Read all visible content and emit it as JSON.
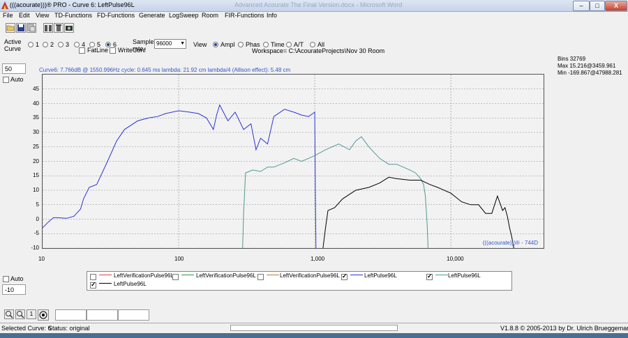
{
  "window": {
    "title": "(((acourate)))® PRO - Curve 6: LeftPulse96L",
    "background_title": "Advanced Acourate The Final Version.docx - Microsoft Word",
    "controls": [
      "–",
      "□",
      "X"
    ]
  },
  "menu": [
    "File",
    "Edit",
    "View",
    "TD-Functions",
    "FD-Functions",
    "Generate",
    "LogSweep",
    "Room",
    "FIR-Functions",
    "Info"
  ],
  "toolbar": {
    "fatline_label": "FatLine",
    "writeconf_label": "WriteConf",
    "workspace_label": "Workspace= C:\\AcourateProjects\\Nov 30 Room"
  },
  "controls": {
    "active_curve_label": "Active Curve",
    "curve_options": [
      "1",
      "2",
      "3",
      "4",
      "5",
      "6"
    ],
    "selected_curve": "6",
    "sample_rate_label": "Sample rate",
    "sample_rate_value": "96000",
    "view_label": "View",
    "view_options": [
      "Ampl",
      "Phas",
      "Time",
      "A/T",
      "All"
    ],
    "selected_view": "Ampl"
  },
  "plot": {
    "ymax_value": "50",
    "ymin_value": "-10",
    "auto_label": "Auto",
    "info_line": "Curve6:  7.766dB @ 1550.996Hz   cycle: 0.645 ms   lambda: 21.92 cm   lambda/4 (Allison effect): 5.48 cm",
    "watermark": "(((acourate)))® - 744D",
    "stats": [
      "Bins 32769",
      "Max 15.216@3459.961",
      "Min -169.867@47988.281"
    ]
  },
  "legend": [
    {
      "label": "LeftVerificationPulse96L",
      "color": "#e04040",
      "checked": false
    },
    {
      "label": "LeftVerificationPulse96L",
      "color": "#2a9a3a",
      "checked": false
    },
    {
      "label": "LeftVerificationPulse96L",
      "color": "#c07a30",
      "checked": false
    },
    {
      "label": "LeftPulse96L",
      "color": "#2a34d8",
      "checked": true
    },
    {
      "label": "LeftPulse96L",
      "color": "#4f9a90",
      "checked": true
    },
    {
      "label": "LeftPulse96L",
      "color": "#000000",
      "checked": true
    }
  ],
  "status": {
    "selected": "Selected Curve: 6",
    "status": "Status: original",
    "version": "V1.8.8 © 2005-2013 by Dr. Ulrich Brueggemann"
  },
  "chart_data": {
    "type": "line",
    "xscale": "log",
    "xlim": [
      10,
      48000
    ],
    "ylim": [
      -10,
      50
    ],
    "x_ticks": [
      "10",
      "100",
      "1,000",
      "10,000"
    ],
    "y_ticks": [
      "-10",
      "-5",
      "0",
      "5",
      "10",
      "15",
      "20",
      "25",
      "30",
      "35",
      "40",
      "45"
    ],
    "grid": true,
    "series": [
      {
        "name": "LeftPulse96L",
        "color": "#2a34d8",
        "x": [
          10,
          11,
          12,
          13,
          15,
          17,
          19,
          20,
          22,
          25,
          30,
          35,
          40,
          50,
          60,
          70,
          80,
          100,
          120,
          140,
          160,
          180,
          190,
          200,
          230,
          260,
          300,
          340,
          370,
          400,
          450,
          500,
          600,
          700,
          800,
          900,
          1000,
          1010,
          1020
        ],
        "y": [
          -3,
          -1,
          0.5,
          0.5,
          0.3,
          1,
          3.5,
          7,
          11,
          12,
          20,
          27,
          31,
          34,
          35,
          35.5,
          36.5,
          37.5,
          37,
          36.5,
          35,
          31,
          36,
          39.5,
          34,
          37,
          31,
          33,
          24,
          28,
          26,
          35.5,
          38,
          37,
          36,
          35.5,
          37,
          10,
          -10
        ]
      },
      {
        "name": "LeftPulse96L",
        "color": "#4f9a90",
        "x": [
          295,
          300,
          310,
          350,
          400,
          450,
          500,
          600,
          700,
          800,
          900,
          1000,
          1200,
          1500,
          1800,
          2000,
          2200,
          2500,
          3000,
          3500,
          4000,
          5000,
          5500,
          6000,
          6300,
          6500,
          6700,
          6800
        ],
        "y": [
          -10,
          2,
          16,
          17,
          16.5,
          18,
          18,
          19.5,
          21,
          20,
          21,
          22,
          24,
          26,
          24,
          27,
          28.5,
          25,
          21,
          19,
          19,
          17,
          16,
          14,
          12,
          8,
          -2,
          -10
        ]
      },
      {
        "name": "LeftPulse96L",
        "color": "#000000",
        "x": [
          1150,
          1200,
          1250,
          1400,
          1600,
          2000,
          2500,
          3000,
          3500,
          4000,
          5000,
          6000,
          7000,
          8000,
          10000,
          12000,
          14000,
          16000,
          18000,
          20000,
          22000,
          24000,
          25000,
          26000,
          27000,
          28000,
          29000
        ],
        "y": [
          -10,
          -3,
          3,
          4,
          7,
          10,
          11,
          12.5,
          14.5,
          14,
          13.5,
          13.5,
          12,
          11,
          9,
          6,
          5,
          5,
          2,
          2,
          8,
          3,
          4,
          1,
          -3,
          -6,
          -10
        ]
      }
    ]
  }
}
